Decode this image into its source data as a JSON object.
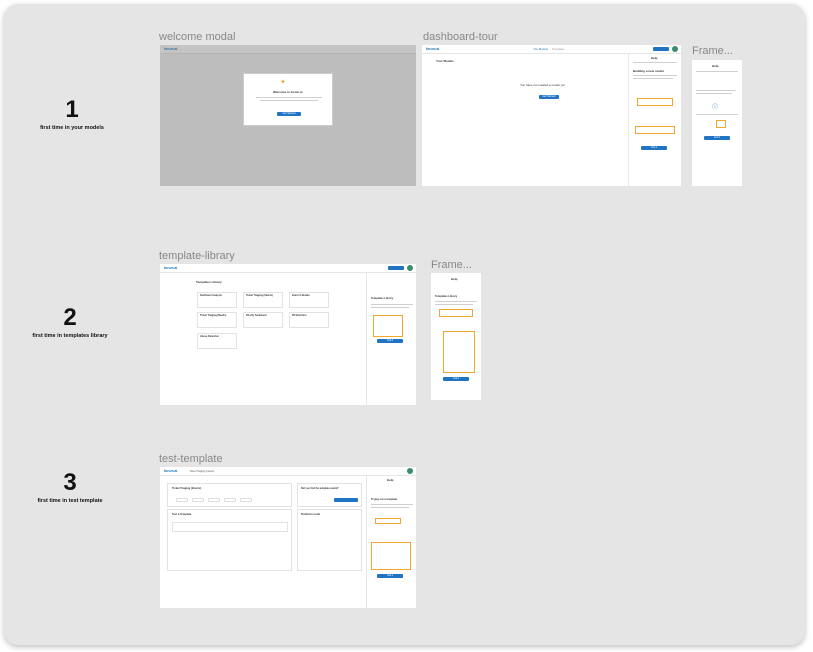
{
  "steps": [
    {
      "number": "1",
      "caption": "first time in your models"
    },
    {
      "number": "2",
      "caption": "first time in templates library"
    },
    {
      "number": "3",
      "caption": "first time in test template"
    }
  ],
  "frames": {
    "welcome_modal": {
      "label": "welcome modal",
      "brand": "forum.ai",
      "modal_title": "Welcome to forum.ai",
      "modal_button": "Get Started"
    },
    "dashboard_tour": {
      "label": "dashboard-tour",
      "brand": "forum.ai",
      "nav_tab_1": "Our Models",
      "nav_tab_2": "Templates",
      "page_title": "Your Models",
      "empty_text": "You have not created a model yet",
      "empty_button": "Get Started",
      "help_title": "Help",
      "help_heading": "Building a new model",
      "help_button": "Got it"
    },
    "frame_1": {
      "label": "Frame...",
      "help_title": "Help",
      "help_button": "Got it"
    },
    "template_library": {
      "label": "template-library",
      "brand": "forum.ai",
      "page_title": "Templates Library",
      "cards": [
        "Sentiment Analysis",
        "Ticket Triaging (Intents)",
        "Intent in Emails",
        "Ticket Triaging (Needs)",
        "Priority Sentiment",
        "PII Detection",
        "Abuse Detection"
      ],
      "help_title": "Templates Library",
      "help_button": "Got it"
    },
    "frame_2": {
      "label": "Frame...",
      "help_title": "Help",
      "help_heading": "Templates Library",
      "help_button": "Got it"
    },
    "test_template": {
      "label": "test-template",
      "brand": "forum.ai",
      "template_name": "Ticket Triaging (Intents)",
      "card_title": "Ticket Triaging (Intents)",
      "test_title": "Test a Template",
      "useful_question": "Did you find the template useful?",
      "results_title": "Prediction result",
      "help_title": "Help",
      "help_heading": "Trying out a template",
      "help_button": "Got it"
    }
  },
  "colors": {
    "accent": "#1f75c4",
    "highlight": "#f2a72e",
    "canvas": "#e5e5e5"
  }
}
